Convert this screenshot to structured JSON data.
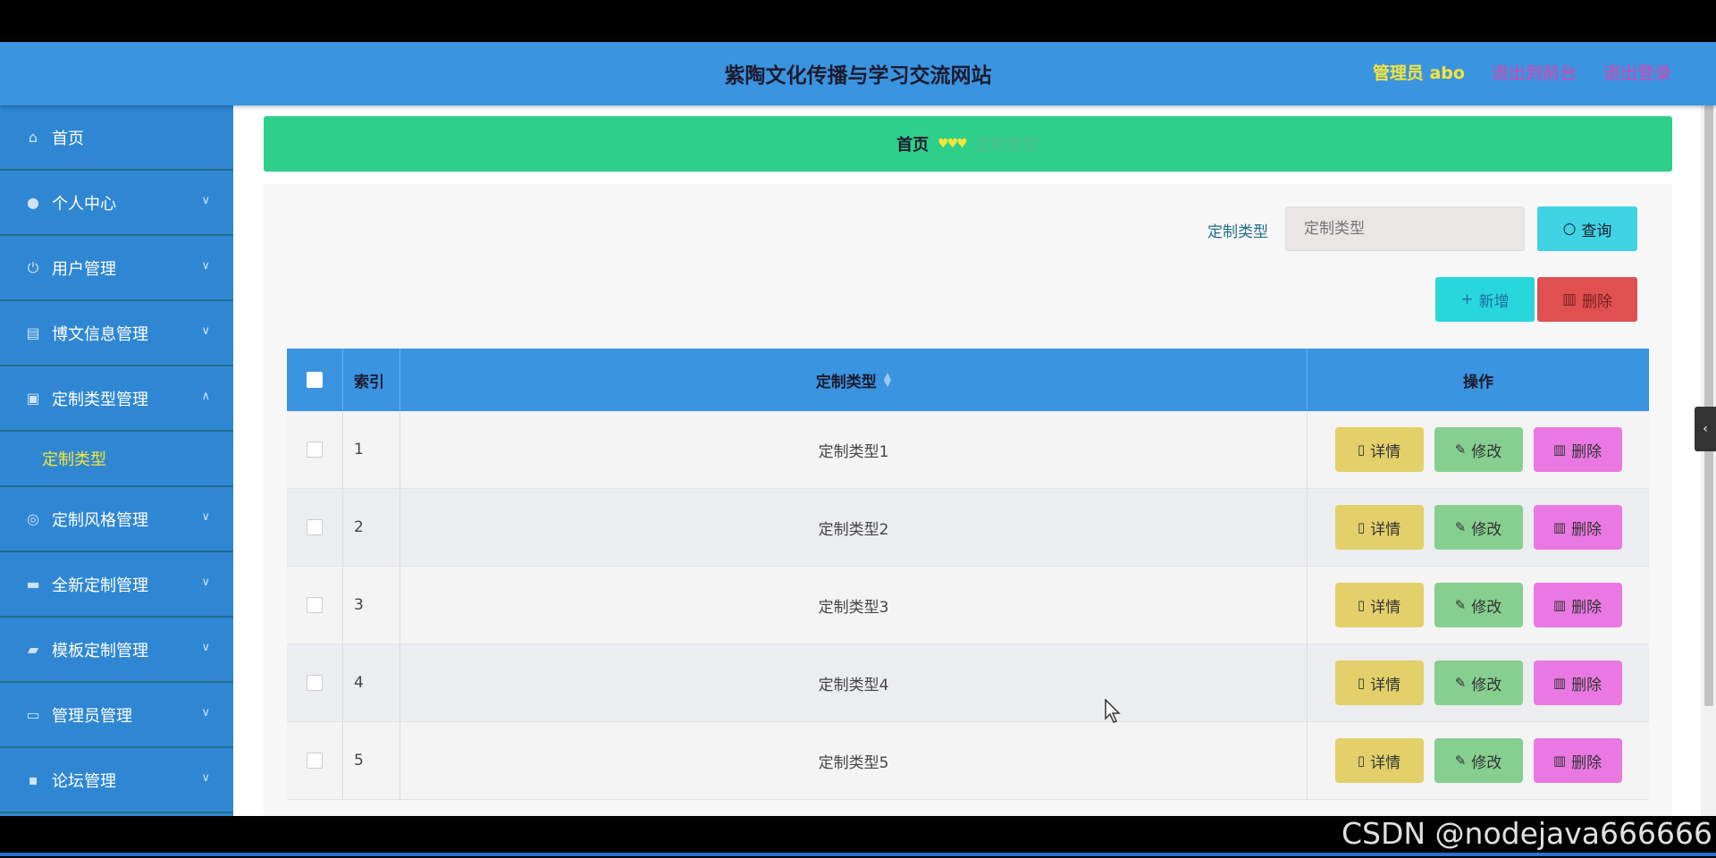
{
  "header": {
    "title": "紫陶文化传播与学习交流网站",
    "admin": "管理员 abo",
    "to_front": "退出到前台",
    "logout": "退出登录"
  },
  "sidebar": {
    "items": [
      {
        "label": "首页",
        "icon": "home-icon"
      },
      {
        "label": "个人中心",
        "icon": "user-icon"
      },
      {
        "label": "用户管理",
        "icon": "power-icon"
      },
      {
        "label": "博文信息管理",
        "icon": "clipboard-icon"
      },
      {
        "label": "定制类型管理",
        "icon": "briefcase-icon"
      },
      {
        "label": "定制风格管理",
        "icon": "target-icon"
      },
      {
        "label": "全新定制管理",
        "icon": "ticket-icon"
      },
      {
        "label": "模板定制管理",
        "icon": "folder-icon"
      },
      {
        "label": "管理员管理",
        "icon": "monitor-icon"
      },
      {
        "label": "论坛管理",
        "icon": "chat-icon"
      }
    ],
    "sub_item": "定制类型"
  },
  "breadcrumb": {
    "home": "首页",
    "separator": "♥♥♥",
    "current": "定制类型"
  },
  "search": {
    "label": "定制类型",
    "placeholder": "定制类型",
    "button": "查询"
  },
  "actions": {
    "add": "新增",
    "delete": "删除"
  },
  "table": {
    "headers": {
      "index": "索引",
      "type": "定制类型",
      "ops": "操作"
    },
    "rows": [
      {
        "index": "1",
        "type": "定制类型1"
      },
      {
        "index": "2",
        "type": "定制类型2"
      },
      {
        "index": "3",
        "type": "定制类型3"
      },
      {
        "index": "4",
        "type": "定制类型4"
      },
      {
        "index": "5",
        "type": "定制类型5"
      }
    ],
    "row_actions": {
      "detail": "详情",
      "edit": "修改",
      "delete": "删除"
    }
  },
  "watermark": "CSDN @nodejava666666",
  "colors": {
    "header": "#3a94e0",
    "sidebar": "#2f87d3",
    "breadcrumb": "#2ecf89",
    "accent_yellow": "#f3e53b",
    "accent_pink": "#e33fb0"
  }
}
